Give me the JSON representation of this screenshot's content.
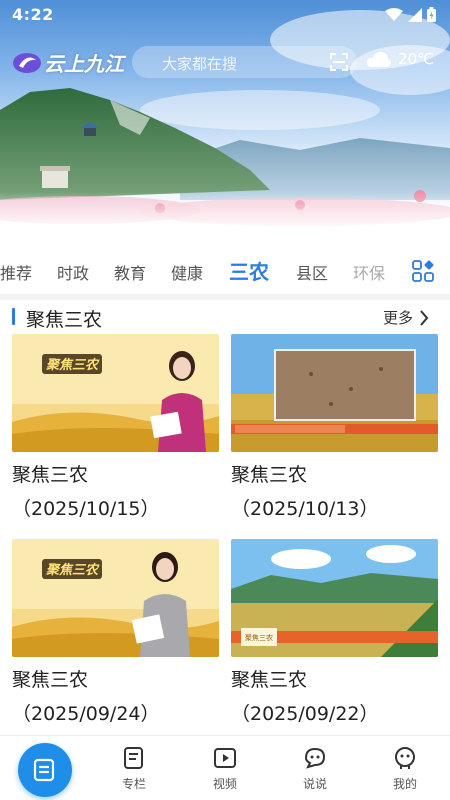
{
  "status_bar": {
    "time": "4:22"
  },
  "header": {
    "logo_text": "云上九江",
    "search_placeholder": "大家都在搜",
    "weather_temp": "20℃"
  },
  "tabs": [
    {
      "label": "推荐"
    },
    {
      "label": "时政"
    },
    {
      "label": "教育"
    },
    {
      "label": "健康"
    },
    {
      "label": "三农",
      "active": true
    },
    {
      "label": "县区"
    },
    {
      "label": "环保"
    }
  ],
  "section": {
    "title": "聚焦三农",
    "more": "更多"
  },
  "cards": [
    {
      "title": "聚焦三农",
      "date": "（2025/10/15）",
      "thumb_caption": "聚焦三农"
    },
    {
      "title": "聚焦三农",
      "date": "（2025/10/13）"
    },
    {
      "title": "聚焦三农",
      "date": "（2025/09/24）",
      "thumb_caption": "聚焦三农"
    },
    {
      "title": "聚焦三农",
      "date": "（2025/09/22）",
      "thumb_caption": "聚焦三农"
    }
  ],
  "bottom_nav": [
    {
      "label": "专栏",
      "icon": "column-icon"
    },
    {
      "label": "视频",
      "icon": "video-icon"
    },
    {
      "label": "说说",
      "icon": "chat-icon"
    },
    {
      "label": "我的",
      "icon": "profile-icon"
    }
  ],
  "colors": {
    "accent": "#2a7be2",
    "nav_accent": "#1f8ee8"
  }
}
